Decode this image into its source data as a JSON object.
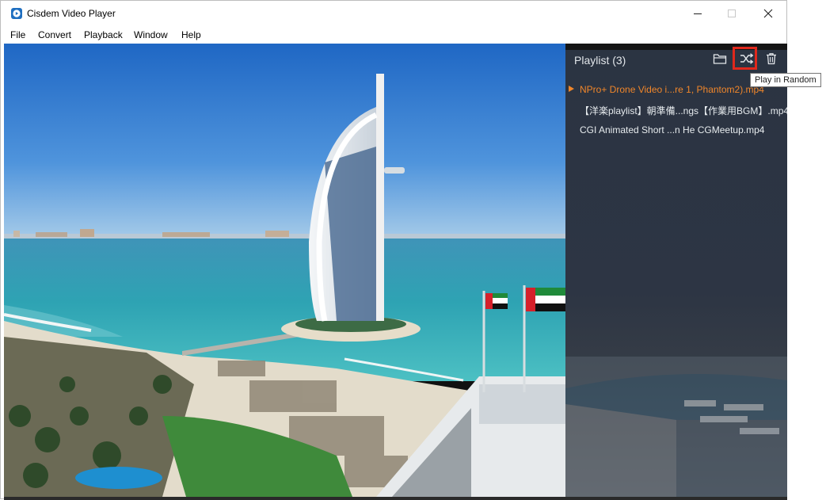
{
  "window": {
    "title": "Cisdem Video Player",
    "controls": {
      "minimize": "minimize-icon",
      "maximize": "maximize-icon",
      "close": "close-icon"
    }
  },
  "menu": {
    "items": [
      {
        "label": "File"
      },
      {
        "label": "Convert"
      },
      {
        "label": "Playback"
      },
      {
        "label": "Window"
      },
      {
        "label": "Help"
      }
    ]
  },
  "playlist": {
    "title": "Playlist (3)",
    "toolbar": {
      "open_folder": "open-folder-icon",
      "random": "shuffle-icon",
      "delete": "trash-icon"
    },
    "tooltip": "Play in Random",
    "items": [
      {
        "label": "NPro+ Drone Video i...re 1, Phantom2).mp4",
        "active": true
      },
      {
        "label": "【洋楽playlist】朝準備...ngs【作業用BGM】.mp4",
        "active": false
      },
      {
        "label": "CGI Animated Short ...n He  CGMeetup.mp4",
        "active": false
      }
    ]
  },
  "colors": {
    "accent": "#f0862a",
    "highlight_box": "#e0281c",
    "panel_bg": "#2b3442",
    "app_icon": "#1f6fc0"
  }
}
